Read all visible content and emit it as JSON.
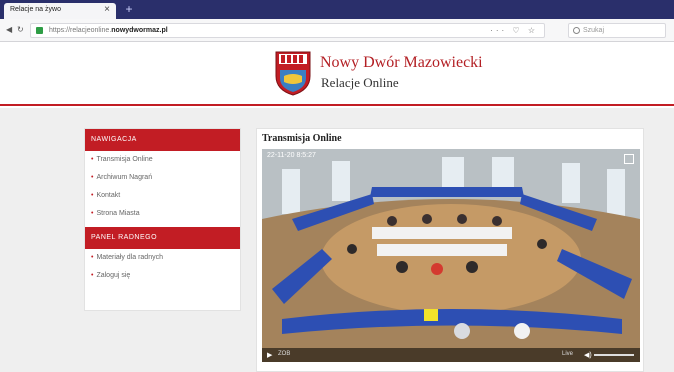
{
  "browser": {
    "tab_title": "Relacje na żywo",
    "tab_close": "×",
    "new_tab": "+",
    "back": "◀",
    "reload": "↻",
    "url_prefix": "https://relacjeonline.",
    "url_domain": "nowydwormaz.pl",
    "url_actions": "··· ♡ ☆",
    "search_placeholder": "Szukaj"
  },
  "header": {
    "title": "Nowy Dwór Mazowiecki",
    "subtitle": "Relacje Online"
  },
  "sidebar": {
    "nav_heading": "Nawigacja",
    "nav_items": [
      {
        "label": "Transmisja Online"
      },
      {
        "label": "Archiwum Nagrań"
      },
      {
        "label": "Kontakt"
      },
      {
        "label": "Strona Miasta"
      }
    ],
    "panel_heading": "Panel Radnego",
    "panel_items": [
      {
        "label": "Materiały dla radnych"
      },
      {
        "label": "Zaloguj się"
      }
    ],
    "bullet": "•"
  },
  "main": {
    "title": "Transmisja Online",
    "video": {
      "timestamp": "22-11-20 8:5:27",
      "play": "▶",
      "live_label": "ZOB",
      "time": "Live",
      "volume": "◀)"
    }
  },
  "colors": {
    "accent": "#c21d24",
    "tabbar": "#2a2f6b"
  }
}
